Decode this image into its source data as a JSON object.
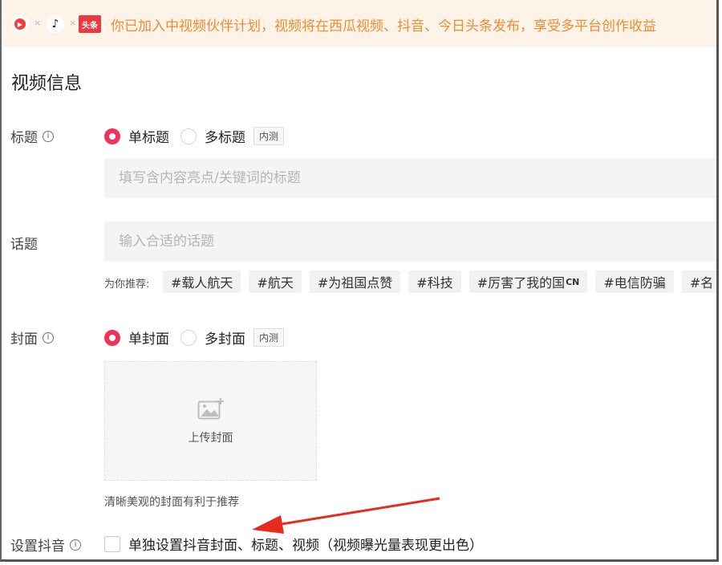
{
  "banner": {
    "xigua_glyph": "▶",
    "douyin_glyph": "♪",
    "toutiao_logo_text": "头条",
    "times": "×",
    "text": "你已加入中视频伙伴计划，视频将在西瓜视频、抖音、今日头条发布，享受多平台创作收益",
    "color": "#f08d2f",
    "background": "#fef3e8"
  },
  "section_title": "视频信息",
  "title_field": {
    "label": "标题",
    "info_glyph": "i",
    "options": [
      "单标题",
      "多标题"
    ],
    "selected": "单标题",
    "beta_badge": "内测",
    "placeholder": "填写含内容亮点/关键词的标题"
  },
  "topic_field": {
    "label": "话题",
    "placeholder": "输入合适的话题",
    "recommend_label": "为你推荐:",
    "tags": [
      "#载人航天",
      "#航天",
      "#为祖国点赞",
      "#科技",
      "#厉害了我的国",
      "#电信防骗",
      "#名"
    ],
    "cn_suffix": "CN"
  },
  "cover_field": {
    "label": "封面",
    "info_glyph": "i",
    "options": [
      "单封面",
      "多封面"
    ],
    "selected": "单封面",
    "beta_badge": "内测",
    "upload_label": "上传封面",
    "hint": "清晰美观的封面有利于推荐"
  },
  "douyin_setting": {
    "label": "设置抖音",
    "info_glyph": "i",
    "checkbox_label": "单独设置抖音封面、标题、视频（视频曝光量表现更出色）",
    "checked": false
  },
  "colors": {
    "accent": "#f1325a",
    "arrow": "#e82a1f"
  }
}
